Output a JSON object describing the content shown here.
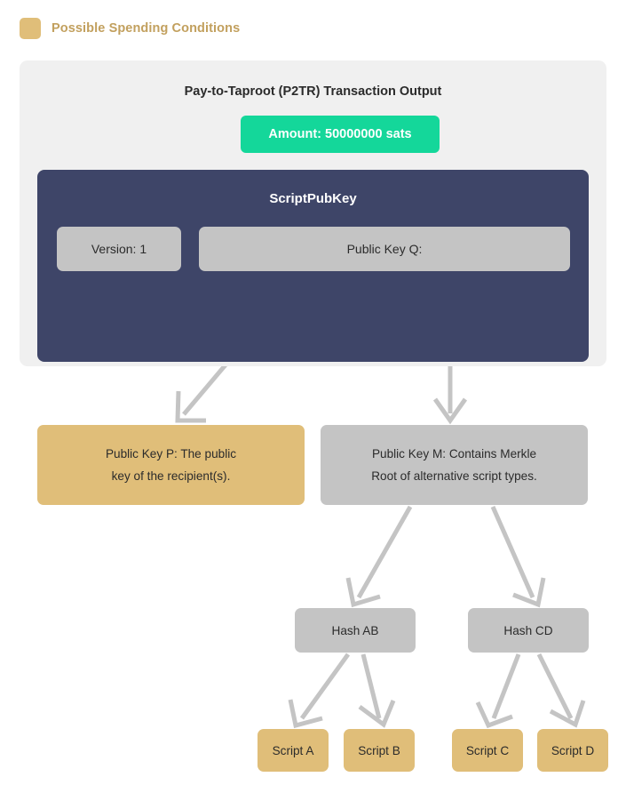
{
  "legend": {
    "swatch_color": "#e0be79",
    "label": "Possible Spending Conditions"
  },
  "transaction_card": {
    "title": "Pay-to-Taproot (P2TR) Transaction Output",
    "amount_badge": {
      "label": "Amount: 50000000 sats",
      "color": "#14d79a"
    },
    "scriptpubkey": {
      "title": "ScriptPubKey",
      "background_color": "#3e4568",
      "fields": [
        {
          "label": "Version: 1"
        },
        {
          "label": "Public Key Q:"
        }
      ]
    },
    "background_color": "#f0f0f0"
  },
  "tree": {
    "spending_conditions": [
      {
        "id": "public-key-p",
        "label": "Public Key P: The public key of the recipient(s).",
        "line1": "Public Key P: The public",
        "line2": "key of the recipient(s).",
        "color": "#e0be79"
      },
      {
        "id": "public-key-m",
        "label": "Public Key M: Contains Merkle Root of alternative script types.",
        "line1": "Public Key M: Contains Merkle",
        "line2": "Root of alternative script types.",
        "color": "#c4c4c4"
      }
    ],
    "hashes": [
      {
        "id": "hash-ab",
        "label": "Hash AB",
        "color": "#c4c4c4"
      },
      {
        "id": "hash-cd",
        "label": "Hash CD",
        "color": "#c4c4c4"
      }
    ],
    "scripts": [
      {
        "id": "script-a",
        "label": "Script A",
        "color": "#e0be79"
      },
      {
        "id": "script-b",
        "label": "Script B",
        "color": "#e0be79"
      },
      {
        "id": "script-c",
        "label": "Script C",
        "color": "#e0be79"
      },
      {
        "id": "script-d",
        "label": "Script D",
        "color": "#e0be79"
      }
    ],
    "arrow_color": "#c4c4c4"
  }
}
